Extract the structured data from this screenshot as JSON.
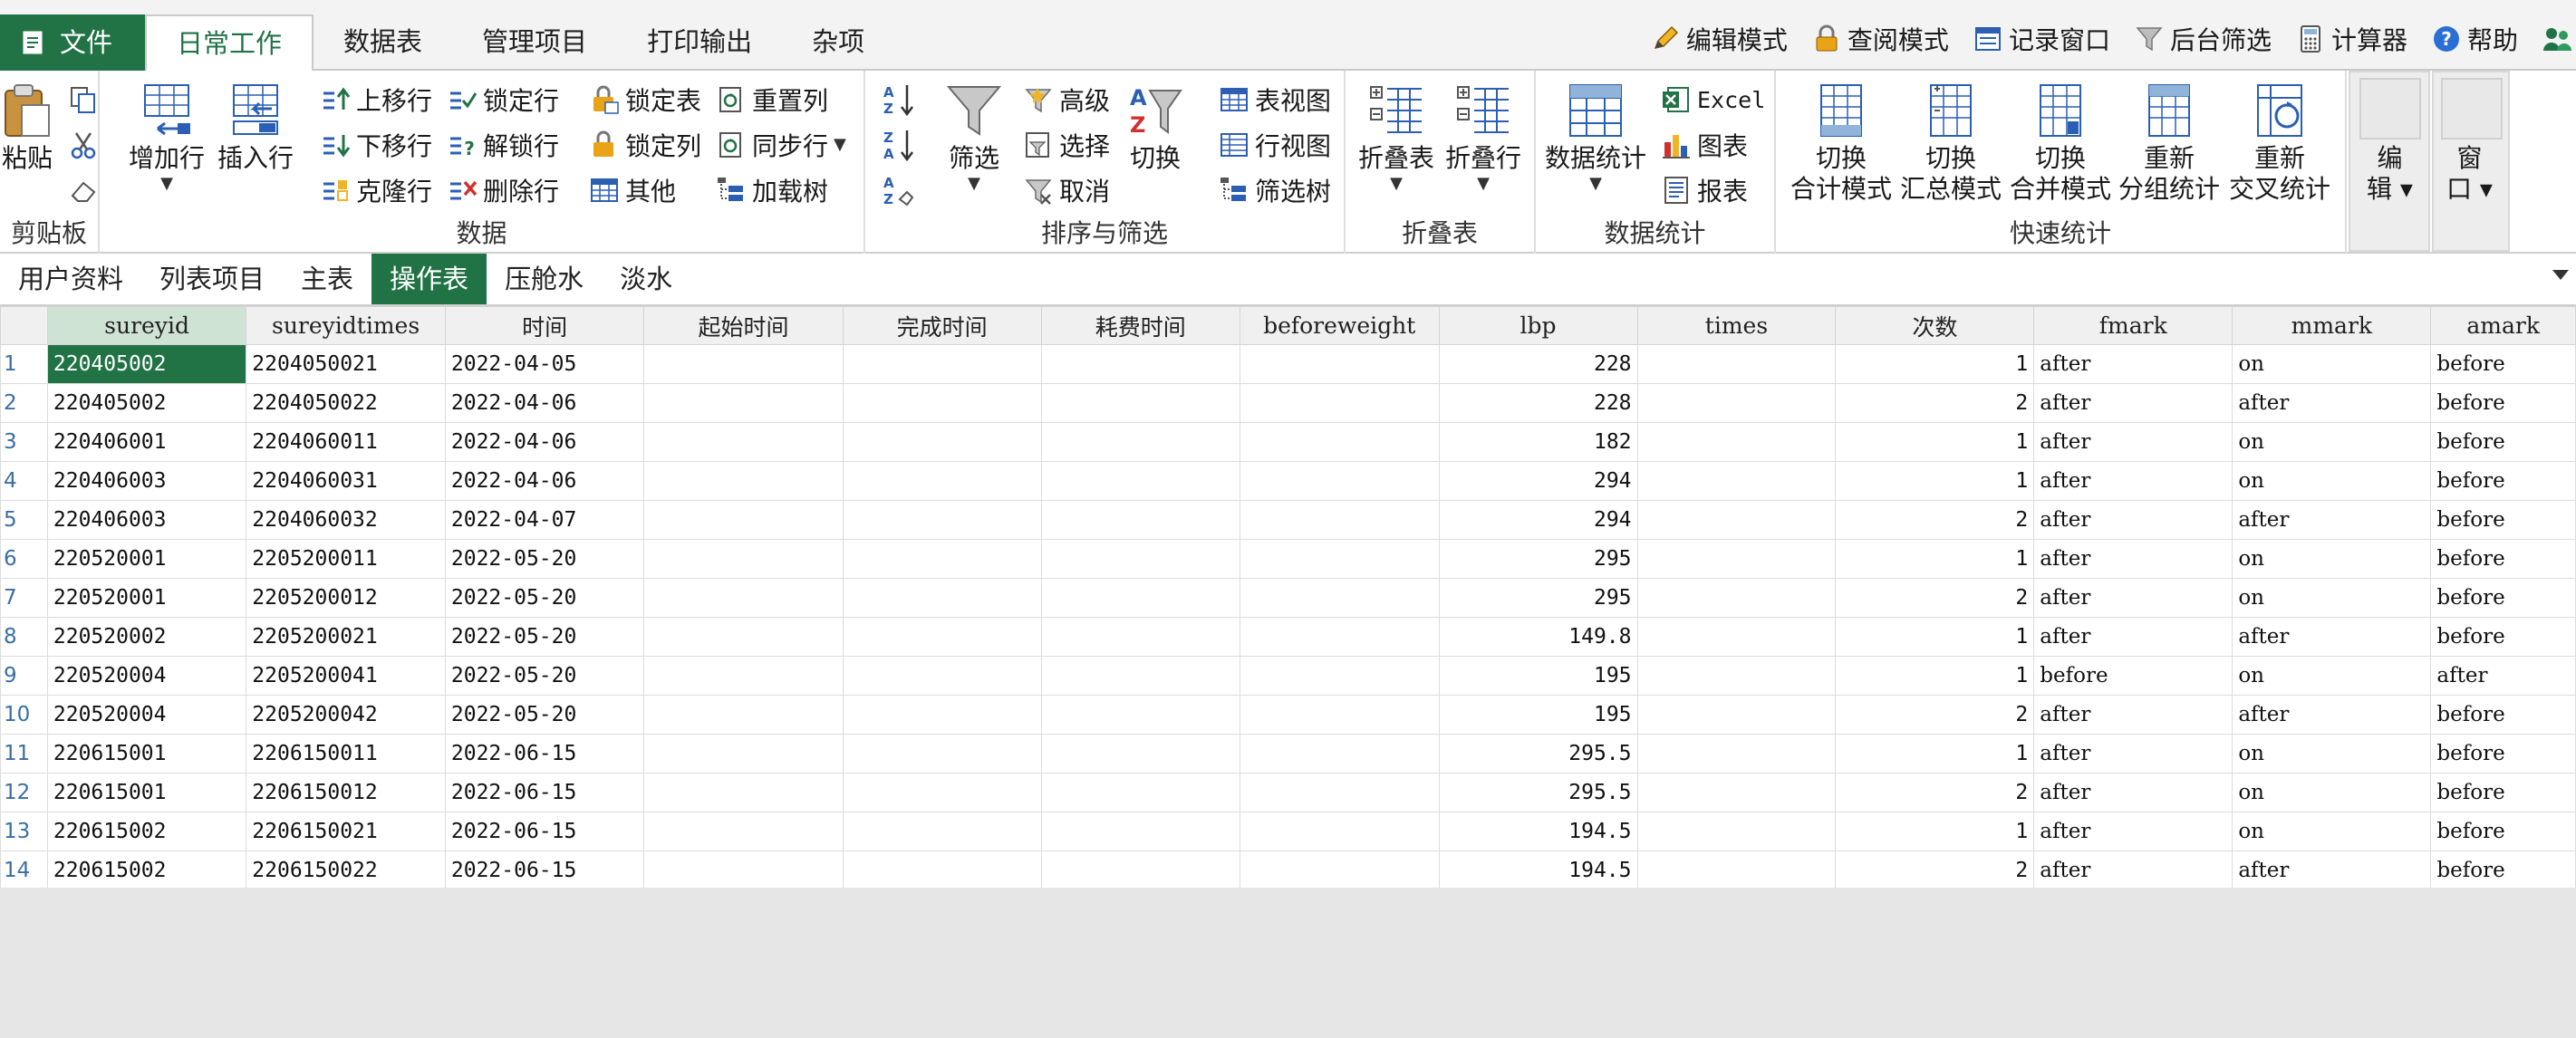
{
  "menu": {
    "file_label": "文件",
    "tabs": [
      "日常工作",
      "数据表",
      "管理项目",
      "打印输出",
      "杂项"
    ],
    "active_tab": "日常工作"
  },
  "quick": {
    "edit_mode": "编辑模式",
    "view_mode": "查阅模式",
    "record_window": "记录窗口",
    "bg_filter": "后台筛选",
    "calculator": "计算器",
    "help": "帮助"
  },
  "ribbon": {
    "clipboard": {
      "label": "剪贴板",
      "paste": "粘贴"
    },
    "data": {
      "label": "数据",
      "add_row": "增加行",
      "insert_row": "插入行",
      "move_up": "上移行",
      "move_down": "下移行",
      "clone_row": "克隆行",
      "lock_row": "锁定行",
      "unlock_row": "解锁行",
      "delete_row": "删除行",
      "lock_table": "锁定表",
      "lock_col": "锁定列",
      "other": "其他",
      "reset_col": "重置列",
      "sync_row": "同步行",
      "load_tree": "加载树"
    },
    "sort": {
      "label": "排序与筛选",
      "filter": "筛选",
      "advanced": "高级",
      "select": "选择",
      "cancel": "取消",
      "switch": "切换",
      "table_view": "表视图",
      "row_view": "行视图",
      "filter_tree": "筛选树"
    },
    "fold": {
      "label": "折叠表",
      "fold_table": "折叠表",
      "fold_row": "折叠行"
    },
    "stats": {
      "label": "数据统计",
      "data_stats": "数据统计",
      "excel": "Excel",
      "chart": "图表",
      "report": "报表"
    },
    "quick_stats": {
      "label": "快速统计",
      "items": [
        {
          "line1": "切换",
          "line2": "合计模式"
        },
        {
          "line1": "切换",
          "line2": "汇总模式"
        },
        {
          "line1": "切换",
          "line2": "合并模式"
        },
        {
          "line1": "重新",
          "line2": "分组统计"
        },
        {
          "line1": "重新",
          "line2": "交叉统计"
        }
      ]
    },
    "edit": {
      "line1": "编",
      "line2": "辑"
    },
    "window": {
      "line1": "窗",
      "line2": "口"
    }
  },
  "sheets": {
    "tabs": [
      "用户资料",
      "列表项目",
      "主表",
      "操作表",
      "压舱水",
      "淡水"
    ],
    "active": "操作表"
  },
  "table": {
    "columns": [
      "sureyid",
      "sureyidtimes",
      "时间",
      "起始时间",
      "完成时间",
      "耗费时间",
      "beforeweight",
      "lbp",
      "times",
      "次数",
      "fmark",
      "mmark",
      "amark"
    ],
    "rows": [
      [
        "1",
        "220405002",
        "2204050021",
        "2022-04-05",
        "",
        "",
        "",
        "",
        "228",
        "",
        "1",
        "after",
        "on",
        "before"
      ],
      [
        "2",
        "220405002",
        "2204050022",
        "2022-04-06",
        "",
        "",
        "",
        "",
        "228",
        "",
        "2",
        "after",
        "after",
        "before"
      ],
      [
        "3",
        "220406001",
        "2204060011",
        "2022-04-06",
        "",
        "",
        "",
        "",
        "182",
        "",
        "1",
        "after",
        "on",
        "before"
      ],
      [
        "4",
        "220406003",
        "2204060031",
        "2022-04-06",
        "",
        "",
        "",
        "",
        "294",
        "",
        "1",
        "after",
        "on",
        "before"
      ],
      [
        "5",
        "220406003",
        "2204060032",
        "2022-04-07",
        "",
        "",
        "",
        "",
        "294",
        "",
        "2",
        "after",
        "after",
        "before"
      ],
      [
        "6",
        "220520001",
        "2205200011",
        "2022-05-20",
        "",
        "",
        "",
        "",
        "295",
        "",
        "1",
        "after",
        "on",
        "before"
      ],
      [
        "7",
        "220520001",
        "2205200012",
        "2022-05-20",
        "",
        "",
        "",
        "",
        "295",
        "",
        "2",
        "after",
        "on",
        "before"
      ],
      [
        "8",
        "220520002",
        "2205200021",
        "2022-05-20",
        "",
        "",
        "",
        "",
        "149.8",
        "",
        "1",
        "after",
        "after",
        "before"
      ],
      [
        "9",
        "220520004",
        "2205200041",
        "2022-05-20",
        "",
        "",
        "",
        "",
        "195",
        "",
        "1",
        "before",
        "on",
        "after"
      ],
      [
        "10",
        "220520004",
        "2205200042",
        "2022-05-20",
        "",
        "",
        "",
        "",
        "195",
        "",
        "2",
        "after",
        "after",
        "before"
      ],
      [
        "11",
        "220615001",
        "2206150011",
        "2022-06-15",
        "",
        "",
        "",
        "",
        "295.5",
        "",
        "1",
        "after",
        "on",
        "before"
      ],
      [
        "12",
        "220615001",
        "2206150012",
        "2022-06-15",
        "",
        "",
        "",
        "",
        "295.5",
        "",
        "2",
        "after",
        "on",
        "before"
      ],
      [
        "13",
        "220615002",
        "2206150021",
        "2022-06-15",
        "",
        "",
        "",
        "",
        "194.5",
        "",
        "1",
        "after",
        "on",
        "before"
      ],
      [
        "14",
        "220615002",
        "2206150022",
        "2022-06-15",
        "",
        "",
        "",
        "",
        "194.5",
        "",
        "2",
        "after",
        "after",
        "before"
      ]
    ]
  }
}
